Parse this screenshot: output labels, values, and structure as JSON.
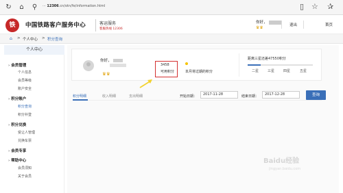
{
  "browser": {
    "url_prefix": "··· ",
    "url_host": "12306",
    "url_rest": ".cn/otn/fe/information.html"
  },
  "header": {
    "logo_text": "铁",
    "site_name": "中国铁路客户服务中心",
    "service": "客运服务",
    "hotline": "客服热线 12306",
    "greeting": "你好，",
    "badges": "♛♛",
    "logout": "退出",
    "home": "首页"
  },
  "breadcrumb": {
    "home_icon": "home-icon",
    "sep1": ">",
    "level1": "个人中心",
    "sep2": ">",
    "current": "积分查询"
  },
  "sidebar": {
    "head": "个人中心",
    "sections": [
      {
        "label": "会员管理",
        "items": [
          "个人信息",
          "会员等级",
          "账户安全"
        ]
      },
      {
        "label": "积分账户",
        "items": [
          "积分查询",
          "积分补登"
        ]
      },
      {
        "label": "积分兑换",
        "items": [
          "受让人管理",
          "兑换车票"
        ]
      },
      {
        "label": "会员专享",
        "items": []
      },
      {
        "label": "帮助中心",
        "items": [
          "会员须知",
          "关于会员"
        ]
      }
    ]
  },
  "card": {
    "greeting": "你好，",
    "badges": "♛♛",
    "points_value": "3458",
    "points_label": "可用积分",
    "expiring_label": "本月将过期的积分",
    "level_title": "距离三星还差47550积分",
    "level_progress": 0.2,
    "levels": [
      "二星",
      "三星",
      "四星",
      "五星"
    ]
  },
  "tabs": [
    "积分明细",
    "收入明细",
    "支出明细"
  ],
  "filter": {
    "start_label": "开始日期：",
    "start_value": "2017-11-28",
    "end_label": "结束日期：",
    "end_value": "2017-12-28",
    "query": "查询"
  },
  "watermark": {
    "main": "Baidu经验",
    "sub": "jingyan.baidu.com"
  },
  "colors": {
    "accent": "#3a6fb8",
    "brand_red": "#c62828",
    "highlight": "#d32f2f"
  }
}
